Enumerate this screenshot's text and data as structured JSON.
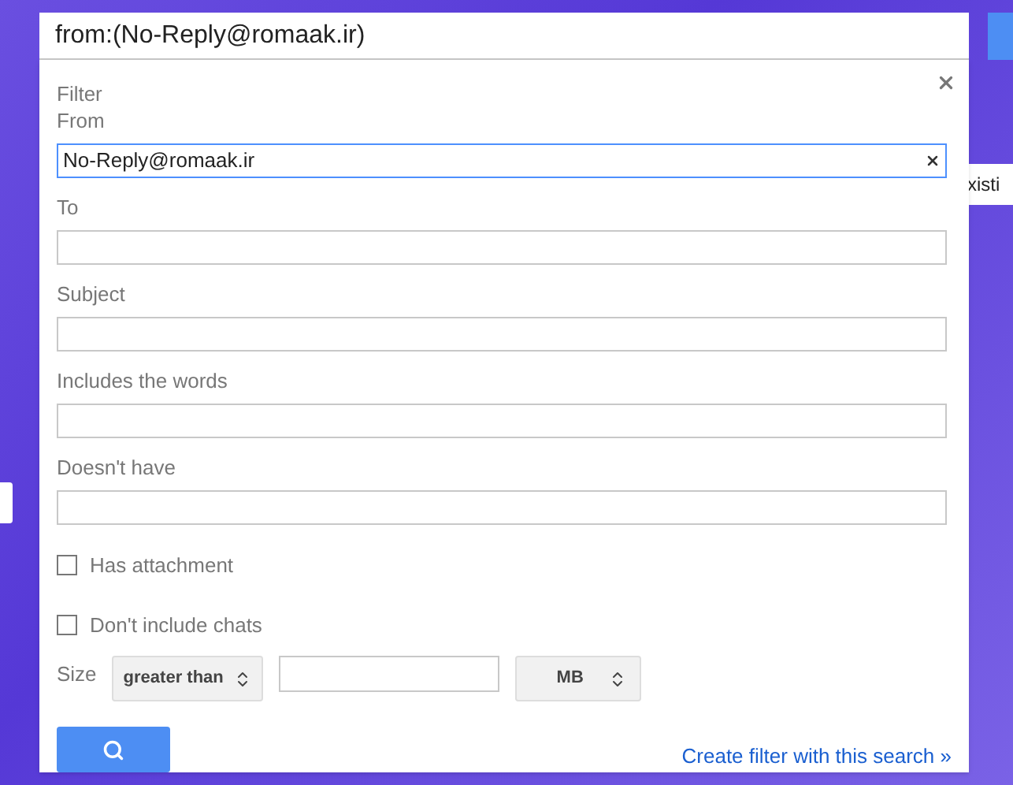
{
  "search_bar": {
    "value": "from:(No-Reply@romaak.ir)"
  },
  "background": {
    "side_text": "xisti"
  },
  "filter_panel": {
    "title": "Filter",
    "fields": [
      {
        "label": "From",
        "value": "No-Reply@romaak.ir",
        "focused": true
      },
      {
        "label": "To",
        "focused": false
      },
      {
        "label": "Subject",
        "focused": false
      },
      {
        "label": "Includes the words",
        "focused": false
      },
      {
        "label": "Doesn't have",
        "focused": false
      }
    ],
    "checkboxes": [
      {
        "label": "Has attachment",
        "checked": false
      },
      {
        "label": "Don't include chats",
        "checked": false
      }
    ],
    "size": {
      "label": "Size",
      "operator": "greater than",
      "unit": "MB"
    },
    "create_filter_link": "Create filter with this search »"
  }
}
